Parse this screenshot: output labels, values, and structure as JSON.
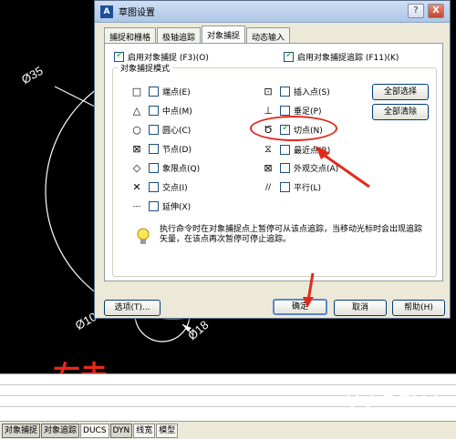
{
  "canvas": {
    "dims": {
      "d35": "Ø35",
      "d10": "Ø10",
      "d18": "Ø18"
    }
  },
  "dialog": {
    "title": "草图设置",
    "title_buttons": {
      "help": "?",
      "close": "X"
    },
    "tabs": [
      "捕捉和栅格",
      "极轴追踪",
      "对象捕捉",
      "动态输入"
    ],
    "active_tab": "对象捕捉",
    "enable_snap": {
      "label": "启用对象捕捉 (F3)(O)",
      "checked": true
    },
    "enable_tracking": {
      "label": "启用对象捕捉追踪 (F11)(K)",
      "checked": true
    },
    "group_title": "对象捕捉模式",
    "left_modes": [
      {
        "symbol": "□",
        "label": "端点(E)",
        "checked": false
      },
      {
        "symbol": "△",
        "label": "中点(M)",
        "checked": false
      },
      {
        "symbol": "○",
        "label": "圆心(C)",
        "checked": false
      },
      {
        "symbol": "⊠",
        "label": "节点(D)",
        "checked": false
      },
      {
        "symbol": "◇",
        "label": "象限点(Q)",
        "checked": false
      },
      {
        "symbol": "✕",
        "label": "交点(I)",
        "checked": false
      },
      {
        "symbol": "---",
        "label": "延伸(X)",
        "checked": false
      }
    ],
    "right_modes": [
      {
        "symbol": "⊡",
        "label": "插入点(S)",
        "checked": false
      },
      {
        "symbol": "⊥",
        "label": "垂足(P)",
        "checked": false
      },
      {
        "symbol": "Ծ",
        "label": "切点(N)",
        "checked": true
      },
      {
        "symbol": "⧖",
        "label": "最近点(R)",
        "checked": false
      },
      {
        "symbol": "⊠",
        "label": "外观交点(A)",
        "checked": false
      },
      {
        "symbol": "//",
        "label": "平行(L)",
        "checked": false
      }
    ],
    "select_all": "全部选择",
    "clear_all": "全部清除",
    "hint": "执行命令时在对象捕捉点上暂停可从该点追踪，当移动光标时会出现追踪矢量，在该点再次暂停可停止追踪。",
    "options_btn": "选项(T)...",
    "ok_btn": "确定",
    "cancel_btn": "取消",
    "help_btn": "帮助(H)"
  },
  "annotation": {
    "right_click": "右击"
  },
  "status_bar": [
    "对象捕捉",
    "对象追踪",
    "DUCS",
    "DYN",
    "线宽",
    "模型"
  ],
  "watermark": {
    "name": "溜溜自学",
    "url": "ZIXUE.3D66.COM"
  }
}
